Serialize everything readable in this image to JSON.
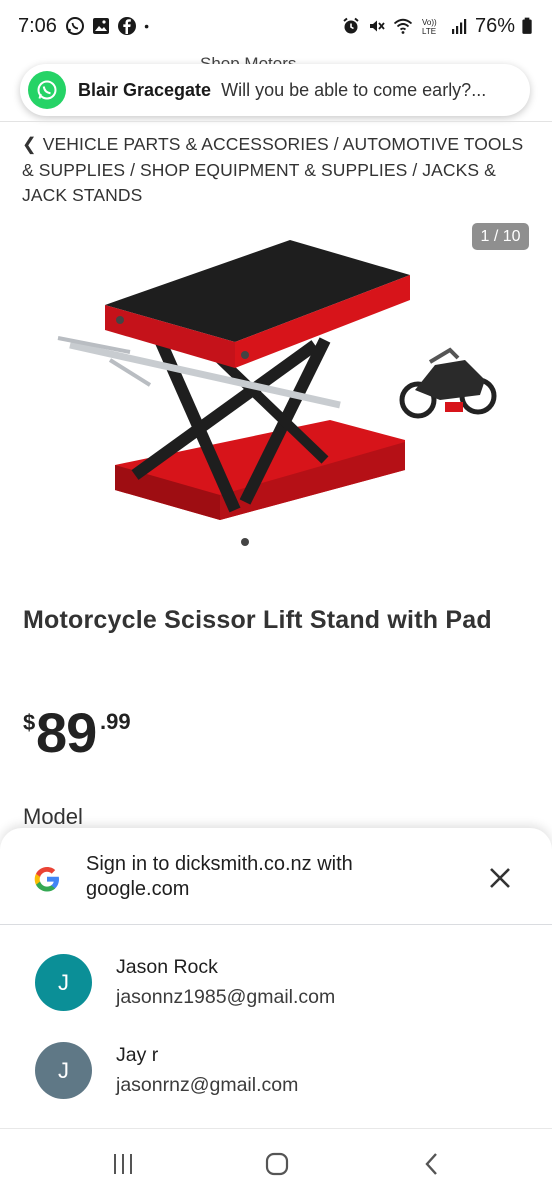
{
  "status_bar": {
    "time": "7:06",
    "battery_percent": "76%",
    "left_icons": [
      "whatsapp-icon",
      "gallery-icon",
      "facebook-icon",
      "dot-icon"
    ],
    "right_icons": [
      "alarm-icon",
      "mute-icon",
      "wifi-icon",
      "volte-icon",
      "signal-icon",
      "battery-icon"
    ]
  },
  "site_header": {
    "faded_text": "Shop Motors"
  },
  "notification": {
    "app": "WhatsApp",
    "sender": "Blair Gracegate",
    "message": "Will you be able to come early?..."
  },
  "breadcrumb": {
    "text": "VEHICLE PARTS & ACCESSORIES / AUTOMOTIVE TOOLS & SUPPLIES / SHOP EQUIPMENT & SUPPLIES / JACKS & JACK STANDS"
  },
  "product": {
    "image_counter": "1 / 10",
    "title": "Motorcycle Scissor Lift Stand with Pad",
    "price_currency": "$",
    "price_whole": "89",
    "price_cents": ".99",
    "model_label": "Model",
    "image_colors": {
      "frame": "#d7141a",
      "pad": "#1e1e1e",
      "metal": "#c8ccd0"
    }
  },
  "signin_sheet": {
    "title": "Sign in to dicksmith.co.nz with google.com",
    "accounts": [
      {
        "initial": "J",
        "name": "Jason Rock",
        "email": "jasonnz1985@gmail.com",
        "color": "#0b8f97"
      },
      {
        "initial": "J",
        "name": "Jay r",
        "email": "jasonrnz@gmail.com",
        "color": "#5f7886"
      }
    ]
  },
  "nav_bar": {
    "buttons": [
      "recents-icon",
      "home-icon",
      "back-icon"
    ]
  }
}
